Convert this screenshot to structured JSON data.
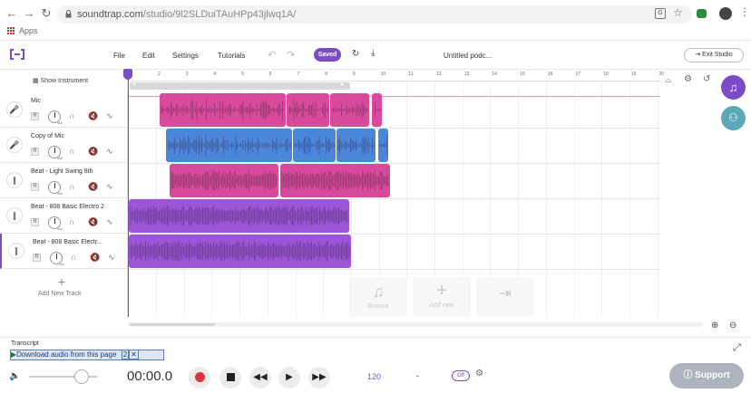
{
  "browser": {
    "url_host": "soundtrap.com",
    "url_path": "/studio/9l2SLDuiTAuHPp43jlwq1A/",
    "apps_label": "Apps"
  },
  "header": {
    "menu": [
      "File",
      "Edit",
      "Settings",
      "Tutorials"
    ],
    "saved_label": "Saved",
    "project_title": "Untitled podc...",
    "exit_label": "Exit Studio"
  },
  "left_panel": {
    "show_instrument": "Show Instrument",
    "add_new_track": "Add New Track",
    "tracks": [
      {
        "name": "Mic",
        "icon": "mic-icon"
      },
      {
        "name": "Copy of Mic",
        "icon": "mic-icon"
      },
      {
        "name": "Beat - Light Swing 8th",
        "icon": "beat-icon"
      },
      {
        "name": "Beat - 808 Basic Electro 2",
        "icon": "beat-icon"
      },
      {
        "name": "Beat - 808 Basic Electr...",
        "icon": "beat-icon"
      }
    ],
    "r_label": "R",
    "vol_label": "Vol"
  },
  "ruler": [
    "2",
    "3",
    "4",
    "5",
    "6",
    "7",
    "8",
    "9",
    "10",
    "11",
    "12",
    "13",
    "14",
    "15",
    "16",
    "17",
    "18",
    "19",
    "20"
  ],
  "add_panel": {
    "browse": "Browse",
    "add_new": "Add new"
  },
  "transport": {
    "download_label": "Download audio from this page",
    "time": "00:00.0",
    "bpm": "120",
    "key": "-",
    "metronome": "Off",
    "support": "Support",
    "transcript": "Transcript"
  },
  "colors": {
    "accent": "#7b4bc8",
    "pink_clip": "#d94a9a",
    "blue_clip": "#4a86d9",
    "purple_clip": "#9b55d6"
  }
}
